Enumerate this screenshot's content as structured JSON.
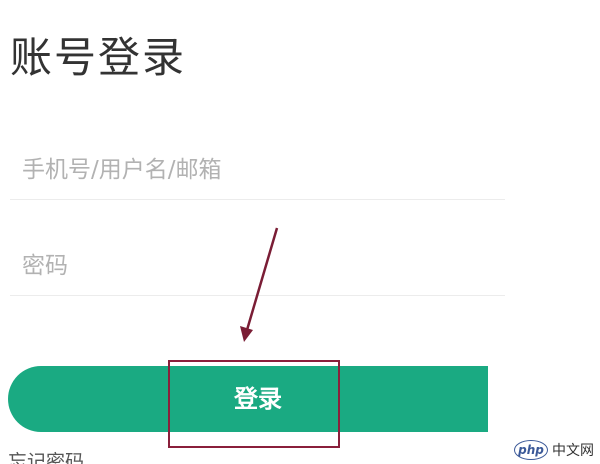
{
  "page": {
    "title": "账号登录"
  },
  "form": {
    "account_placeholder": "手机号/用户名/邮箱",
    "account_value": "",
    "password_placeholder": "密码",
    "password_value": "",
    "login_label": "登录",
    "forgot_label": "忘记密码"
  },
  "watermark": {
    "logo_text": "php",
    "site_text": "中文网"
  },
  "colors": {
    "button": "#1aaa82",
    "highlight": "#8a1f3b",
    "arrow": "#7a1d35"
  },
  "annotation": {
    "arrow_icon": "arrow-pointing-down-icon"
  }
}
